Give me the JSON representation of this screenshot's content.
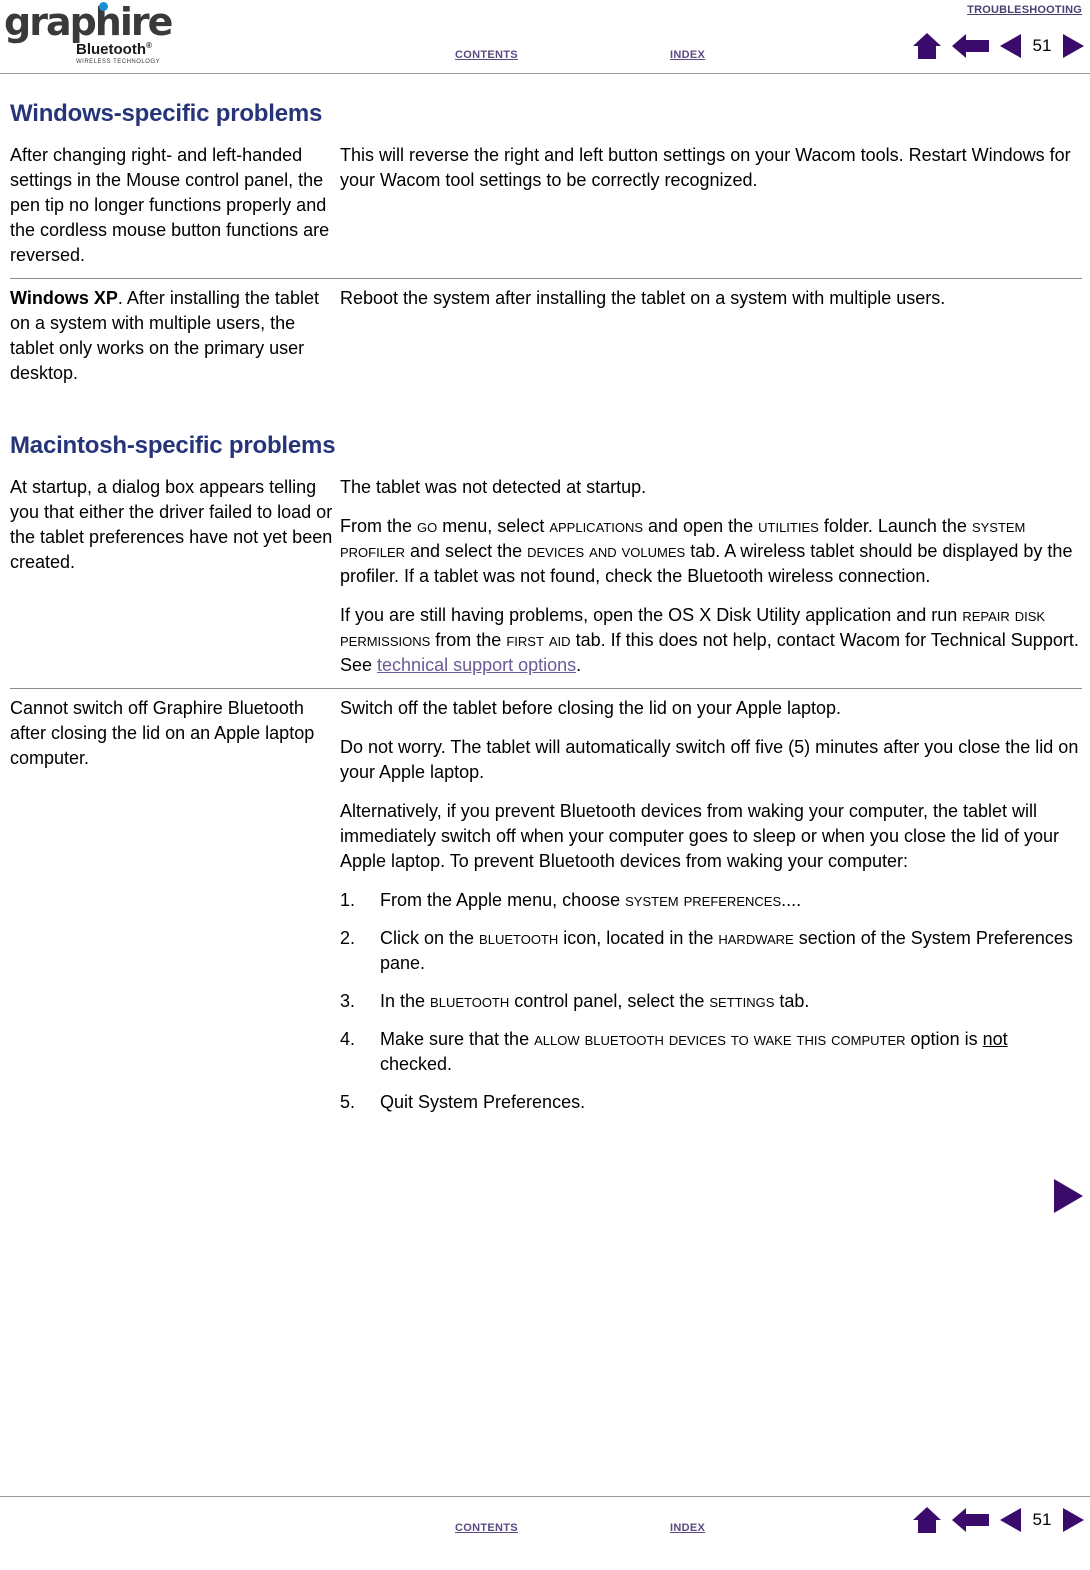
{
  "logo": {
    "word": "graphire",
    "bluetooth": "Bluetooth",
    "tagline": "WIRELESS TECHNOLOGY"
  },
  "header": {
    "title": "Troubleshooting",
    "contents_label": "Contents",
    "index_label": "Index",
    "page_number": "51",
    "accent_color": "#3B0B6B",
    "link_color": "#5b4b82"
  },
  "footer": {
    "contents_label": "Contents",
    "index_label": "Index",
    "page_number": "51"
  },
  "sections": [
    {
      "heading": "Windows-specific problems",
      "rows": [
        {
          "problem_prefix": "",
          "problem": "After changing right- and left-handed settings in the Mouse control panel, the pen tip no longer functions properly and the cordless mouse button functions are reversed.",
          "solution": "This will reverse the right and left button settings on your Wacom tools. Restart Windows for your Wacom tool settings to be correctly recognized."
        },
        {
          "problem_prefix": "Windows XP",
          "problem": ".  After installing the tablet on a system with multiple users, the tablet only works on the primary user desktop.",
          "solution": "Reboot the system after installing the tablet on a system with multiple users."
        }
      ]
    },
    {
      "heading": "Macintosh-specific problems",
      "rows": [
        {
          "problem": "At startup, a dialog box appears telling you that either the driver failed to load or the tablet preferences have not yet been created.",
          "solution_p1": "The tablet was not detected at startup.",
          "solution_p2": {
            "a": "From the ",
            "sc1": "Go",
            "b": " menu, select ",
            "sc2": "Applications",
            "c": " and open the ",
            "sc3": "Utilities",
            "d": " folder. Launch the ",
            "sc4": "System Profiler",
            "e": " and select the ",
            "sc5": "Devices and Volumes",
            "f": " tab.  A wireless tablet should be displayed by the profiler.  If a tablet was not found, check the Bluetooth wireless connection."
          },
          "solution_p3": {
            "a": "If you are still having problems, open the OS X Disk Utility application and run ",
            "sc1": "Repair Disk Permissions",
            "b": " from the ",
            "sc2": "First Aid",
            "c": " tab.  If this does not help, contact Wacom for Technical Support.  See ",
            "link": "technical support options",
            "d": "."
          }
        },
        {
          "problem": "Cannot switch off Graphire Bluetooth after closing the lid on an Apple laptop computer.",
          "solution_p1": "Switch off the tablet before closing the lid on your Apple laptop.",
          "solution_p2": "Do not worry.  The tablet will automatically switch off five (5) minutes after you close the lid on your Apple laptop.",
          "solution_p3": "Alternatively, if you prevent Bluetooth devices from waking your computer, the tablet will immediately switch off when your computer goes to sleep or when you close the lid of your Apple laptop.  To prevent Bluetooth devices from waking your computer:",
          "steps": [
            {
              "num": "1.",
              "a": "From the Apple menu, choose ",
              "sc1": "System Preferences",
              "b": "...."
            },
            {
              "num": "2.",
              "a": "Click on the ",
              "sc1": "Bluetooth",
              "b": " icon, located in the ",
              "sc2": "Hardware",
              "c": " section of the System Preferences pane."
            },
            {
              "num": "3.",
              "a": "In the ",
              "sc1": "Bluetooth",
              "b": " control panel, select the ",
              "sc2": "Settings",
              "c": " tab."
            },
            {
              "num": "4.",
              "a": "Make sure that the ",
              "sc1": "Allow Bluetooth devices to wake this computer",
              "b": " option is ",
              "u1": "not",
              "c": " checked."
            },
            {
              "num": "5.",
              "a": "Quit System Preferences."
            }
          ]
        }
      ]
    }
  ],
  "icons": {
    "home": "home-icon",
    "back": "back-arrow-icon",
    "prev": "previous-page-icon",
    "next": "next-page-icon",
    "next_big": "next-page-arrow-icon"
  }
}
